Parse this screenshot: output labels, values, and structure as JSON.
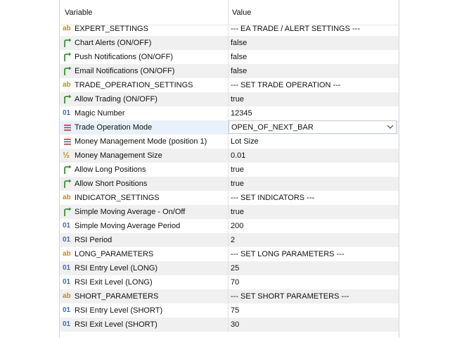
{
  "header": {
    "col_variable": "Variable",
    "col_value": "Value"
  },
  "rows": [
    {
      "name": "EXPERT_SETTINGS",
      "value": "--- EA TRADE / ALERT SETTINGS ---",
      "icon": "string-icon"
    },
    {
      "name": "Chart Alerts (ON/OFF)",
      "value": "false",
      "icon": "bool-arrow-icon"
    },
    {
      "name": "Push Notifications (ON/OFF)",
      "value": "false",
      "icon": "bool-arrow-icon"
    },
    {
      "name": "Email Notifications (ON/OFF)",
      "value": "false",
      "icon": "bool-arrow-icon"
    },
    {
      "name": "TRADE_OPERATION_SETTINGS",
      "value": "--- SET TRADE OPERATION ---",
      "icon": "string-icon"
    },
    {
      "name": "Allow Trading (ON/OFF)",
      "value": "true",
      "icon": "bool-arrow-icon"
    },
    {
      "name": "Magic Number",
      "value": "12345",
      "icon": "int-icon"
    },
    {
      "name": "Trade Operation Mode",
      "value": "OPEN_OF_NEXT_BAR",
      "icon": "enum-list-icon"
    },
    {
      "name": "Money Management Mode (position 1)",
      "value": "Lot Size",
      "icon": "enum-list-icon"
    },
    {
      "name": "Money Management Size",
      "value": "0.01",
      "icon": "double-icon"
    },
    {
      "name": "Allow Long Positions",
      "value": "true",
      "icon": "bool-arrow-icon"
    },
    {
      "name": "Allow Short Positions",
      "value": "true",
      "icon": "bool-arrow-icon"
    },
    {
      "name": "INDICATOR_SETTINGS",
      "value": "--- SET INDICATORS ---",
      "icon": "string-icon"
    },
    {
      "name": "Simple Moving Average - On/Off",
      "value": "true",
      "icon": "bool-arrow-icon"
    },
    {
      "name": "Simple Moving Average Period",
      "value": "200",
      "icon": "int-icon"
    },
    {
      "name": "RSI Period",
      "value": "2",
      "icon": "int-icon"
    },
    {
      "name": "LONG_PARAMETERS",
      "value": "--- SET LONG PARAMETERS ---",
      "icon": "string-icon"
    },
    {
      "name": "RSI Entry Level (LONG)",
      "value": "25",
      "icon": "int-icon"
    },
    {
      "name": "RSI Exit Level (LONG)",
      "value": "70",
      "icon": "int-icon"
    },
    {
      "name": "SHORT_PARAMETERS",
      "value": "--- SET SHORT PARAMETERS ---",
      "icon": "string-icon"
    },
    {
      "name": "RSI Entry Level (SHORT)",
      "value": "75",
      "icon": "int-icon"
    },
    {
      "name": "RSI Exit Level (SHORT)",
      "value": "30",
      "icon": "int-icon"
    }
  ],
  "colors": {
    "string": "#c98a10",
    "bool": "#2e9a2e",
    "int": "#3d6bb3",
    "enum": "#c0392b"
  }
}
